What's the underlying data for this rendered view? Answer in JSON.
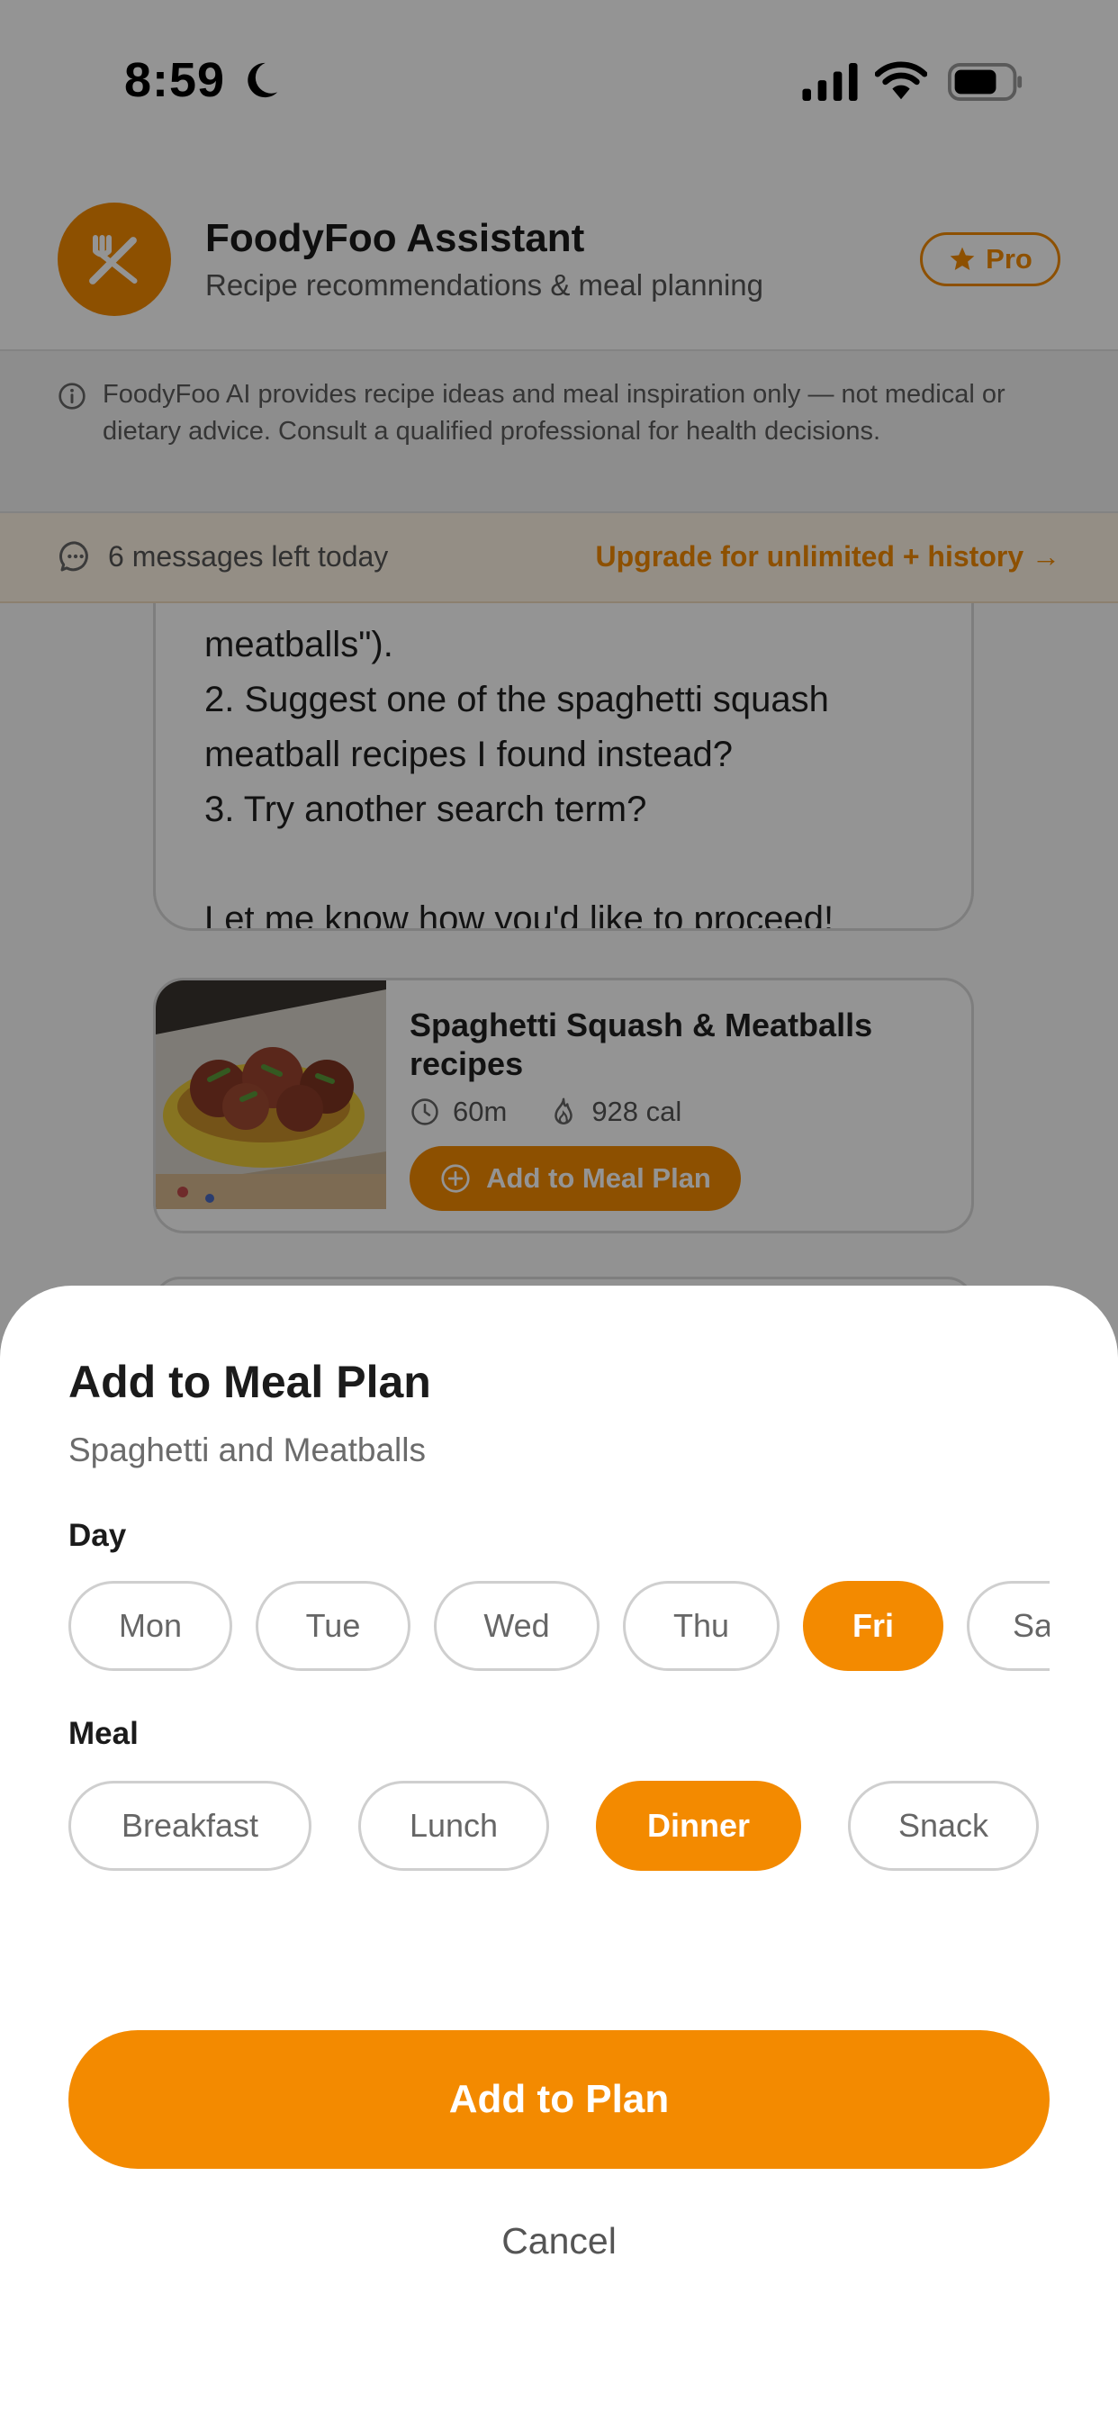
{
  "status_bar": {
    "time": "8:59"
  },
  "header": {
    "title": "FoodyFoo Assistant",
    "subtitle": "Recipe recommendations & meal planning",
    "badge": "Pro"
  },
  "disclaimer": {
    "text": "FoodyFoo AI provides recipe ideas and meal inspiration only — not medical or dietary advice. Consult a qualified professional for health decisions."
  },
  "limit_bar": {
    "text": "6 messages left today",
    "upgrade_link": "Upgrade for unlimited + history →"
  },
  "message": {
    "text": "meatballs\").\n2. Suggest one of the spaghetti squash meatball recipes I found instead?\n3. Try another search term?\n\nLet me know how you'd like to proceed!"
  },
  "recipe_card": {
    "title": "Spaghetti Squash & Meatballs recipes",
    "time": "60m",
    "calories": "928 cal",
    "add_button": "Add to Meal Plan"
  },
  "sheet": {
    "title": "Add to Meal Plan",
    "subtitle": "Spaghetti and Meatballs",
    "day_label": "Day",
    "days": [
      "Mon",
      "Tue",
      "Wed",
      "Thu",
      "Fri",
      "Sa"
    ],
    "selected_day": "Fri",
    "meal_label": "Meal",
    "meals": [
      "Breakfast",
      "Lunch",
      "Dinner",
      "Snack"
    ],
    "selected_meal": "Dinner",
    "add_button": "Add to Plan",
    "cancel_button": "Cancel"
  },
  "colors": {
    "accent": "#f38a00",
    "overlay": "rgba(0,0,0,0.42)"
  }
}
